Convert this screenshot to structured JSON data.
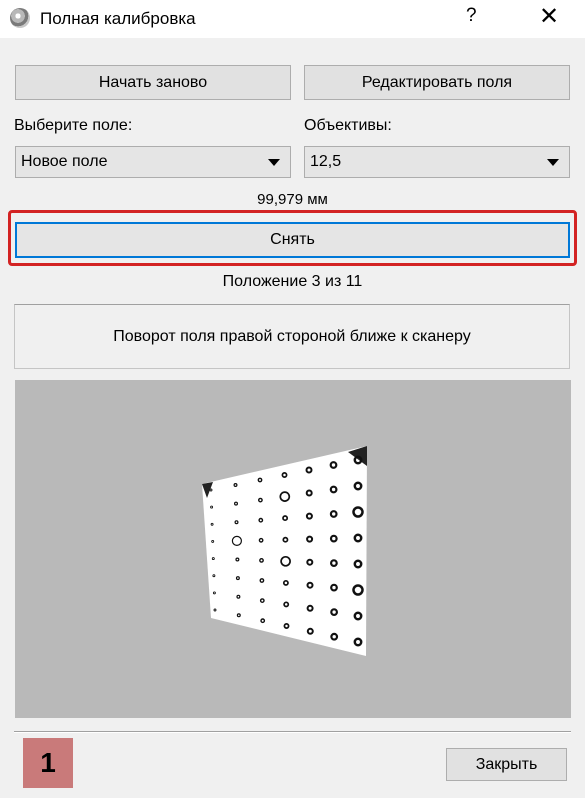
{
  "window": {
    "title": "Полная калибровка",
    "help_label": "?",
    "close_label": "✕"
  },
  "toolbar": {
    "restart_label": "Начать заново",
    "edit_fields_label": "Редактировать поля"
  },
  "field_select": {
    "label": "Выберите поле:",
    "value": "Новое поле"
  },
  "lens_select": {
    "label": "Объективы:",
    "value": "12,5"
  },
  "measurement": "99,979 мм",
  "capture_label": "Снять",
  "position_status": "Положение 3 из 11",
  "instruction": "Поворот поля правой стороной ближе к сканеру",
  "preview": {
    "background": "#b9b9b9",
    "description_icon": "calibration-target-image"
  },
  "footer": {
    "badge": "1",
    "close_label": "Закрыть"
  },
  "colors": {
    "highlight": "#d32323",
    "focus": "#0078d7",
    "badge": "#c97a7a"
  }
}
